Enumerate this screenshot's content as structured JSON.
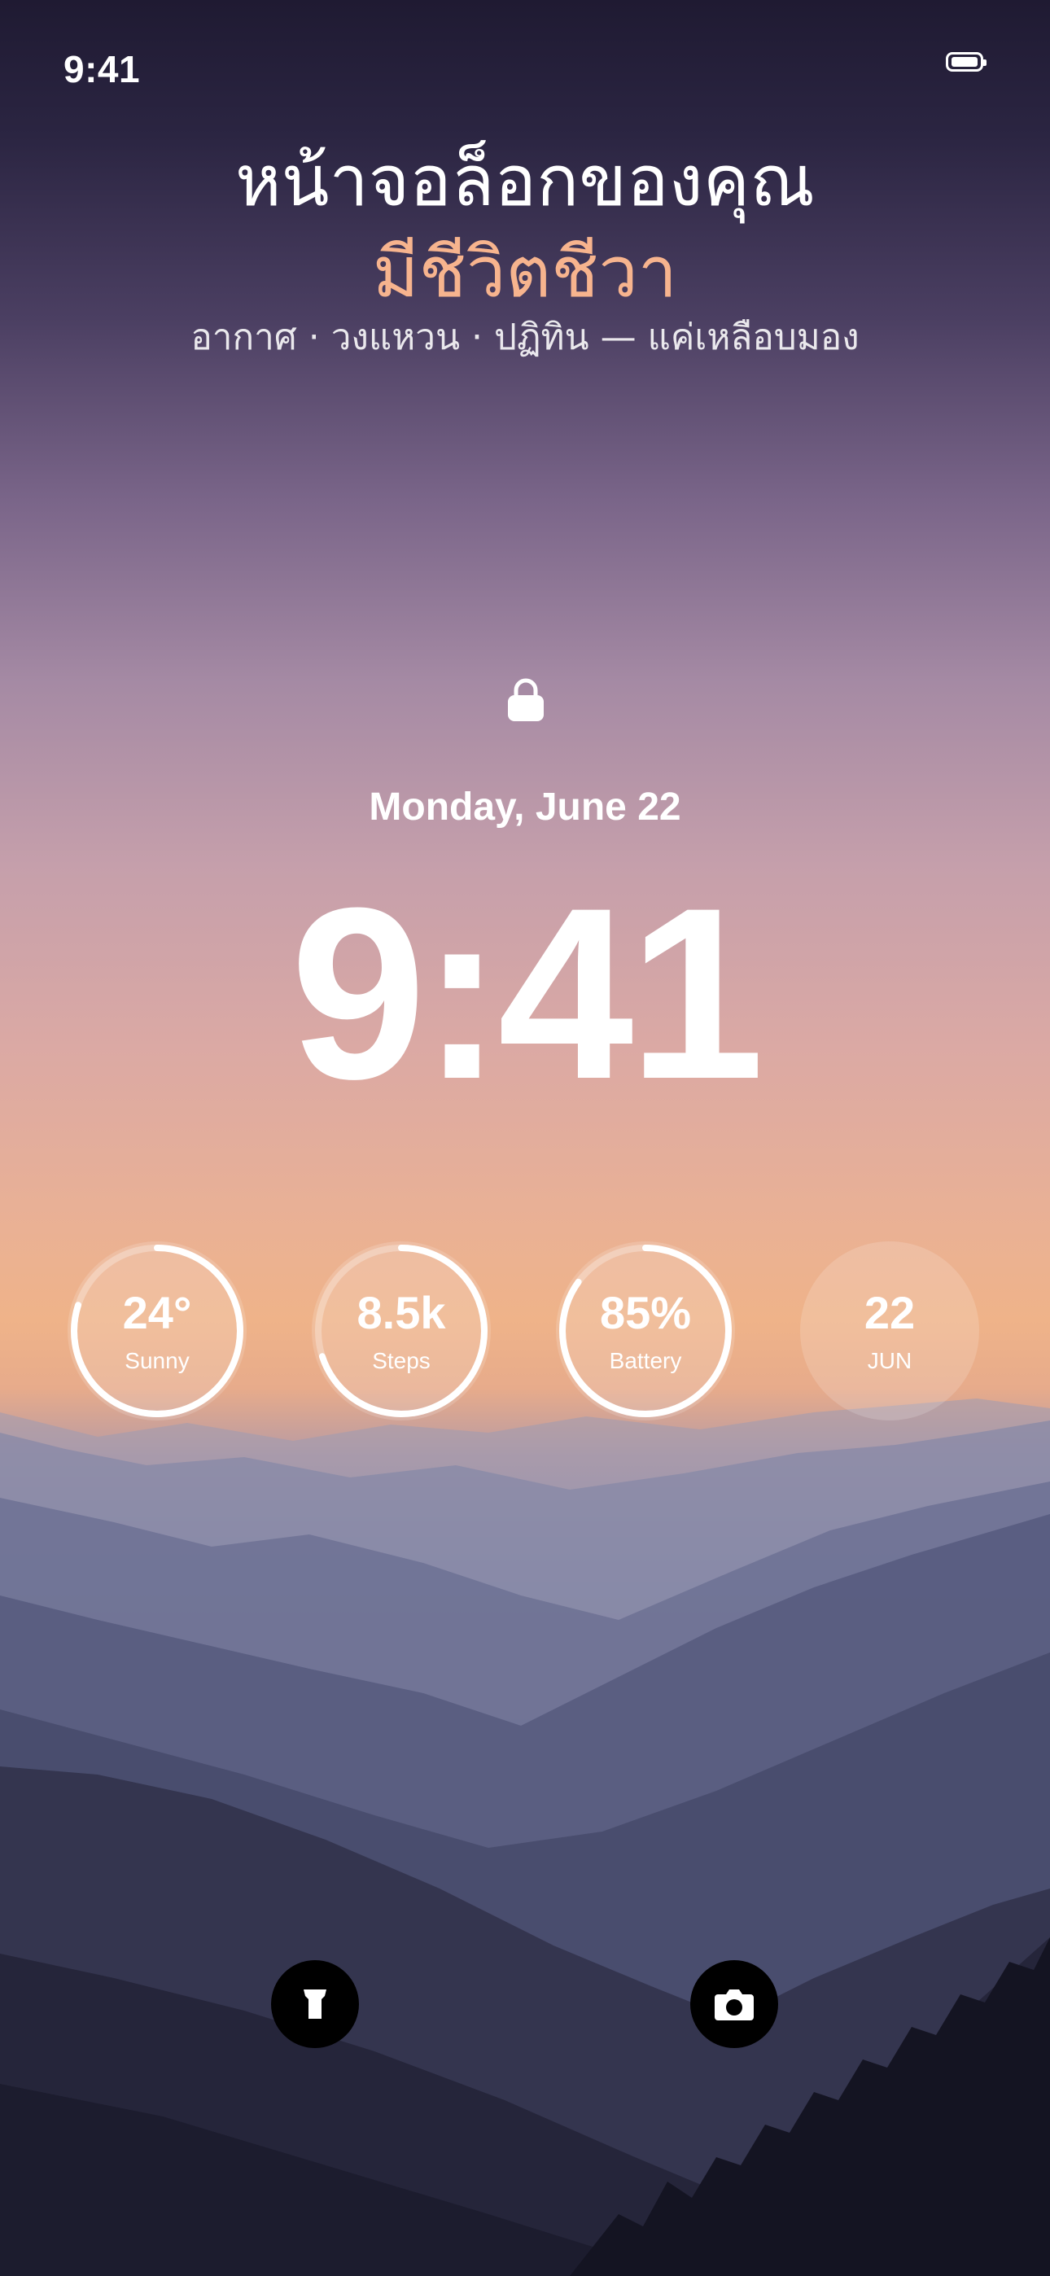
{
  "status_bar": {
    "time": "9:41",
    "battery_icon": "battery-full-icon"
  },
  "promo": {
    "headline": "หน้าจอล็อกของคุณ",
    "headline_accent": "มีชีวิตชีวา",
    "subline": "อากาศ · วงแหวน · ปฏิทิน — แค่เหลือบมอง",
    "accent_color": "#f7b48e"
  },
  "lock_screen": {
    "lock_icon": "lock-icon",
    "date": "Monday, June 22",
    "time": "9:41"
  },
  "widgets": [
    {
      "value": "24°",
      "label": "Sunny",
      "progress": 0.8
    },
    {
      "value": "8.5k",
      "label": "Steps",
      "progress": 0.7
    },
    {
      "value": "85%",
      "label": "Battery",
      "progress": 0.85
    },
    {
      "value": "22",
      "label": "JUN",
      "progress": 0
    }
  ],
  "quick_actions": {
    "left": "flashlight-icon",
    "right": "camera-icon"
  }
}
